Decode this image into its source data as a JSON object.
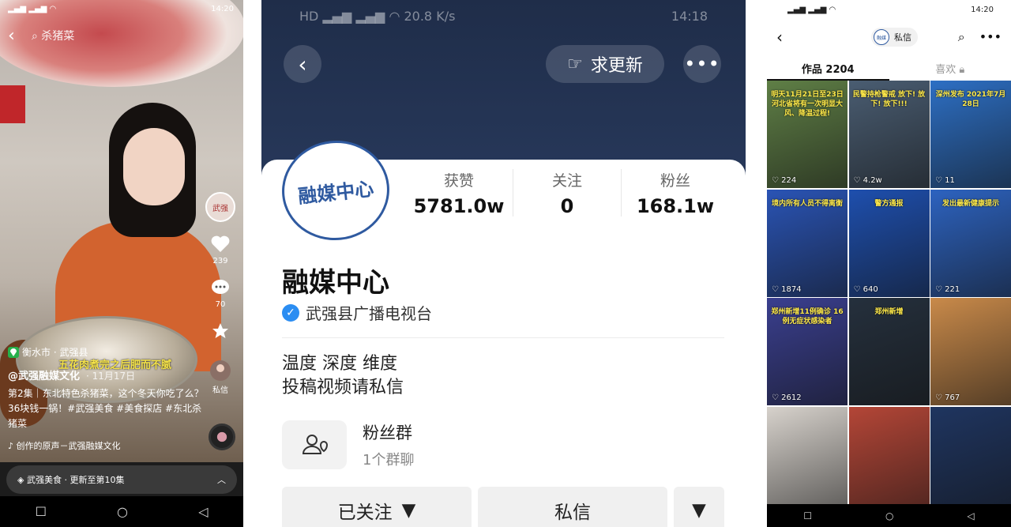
{
  "video": {
    "status": {
      "time": "14:20",
      "speed": "2.8 M/s"
    },
    "search_text": "杀猪菜",
    "location": "衡水市 · 武强县",
    "overlay_text": "五花肉煮完之后肥而不腻",
    "author": "@武强融媒文化",
    "date": "· 11月17日",
    "description": "第2集｜东北特色杀猪菜，这个冬天你吃了么？36块钱一锅！#武强美食 #美食探店 #东北杀猪菜",
    "music": "创作的原声－武强融媒文化",
    "like_count": "239",
    "comment_count": "70",
    "message_label": "私信",
    "collection_label": "武强美食 · 更新至第10集"
  },
  "profile": {
    "status": {
      "time": "14:18",
      "speed": "20.8 K/s"
    },
    "update_button": "求更新",
    "stats": [
      {
        "label": "获赞",
        "value": "5781.0w"
      },
      {
        "label": "关注",
        "value": "0"
      },
      {
        "label": "粉丝",
        "value": "168.1w"
      }
    ],
    "logo_text": "融媒中心",
    "name": "融媒中心",
    "verification": "武强县广播电视台",
    "bio_line1": "温度 深度 维度",
    "bio_line2": "投稿视频请私信",
    "fan_group_title": "粉丝群",
    "fan_group_sub": "1个群聊",
    "follow_button": "已关注",
    "message_button": "私信"
  },
  "works": {
    "status": {
      "time": "14:20",
      "speed": "5.4 K/s"
    },
    "pill_label": "私信",
    "tab_works": "作品 2204",
    "tab_likes": "喜欢",
    "items": [
      {
        "title": "明天11月21日至23日 河北省将有一次明显大风、降温过程!",
        "likes": "224",
        "color": "#5f7f46"
      },
      {
        "title": "民警持枪警戒 放下! 放下! 放下!!!",
        "likes": "4.2w",
        "color": "#4a5d72"
      },
      {
        "title": "深州发布 2021年7月28日",
        "likes": "11",
        "color": "#2d6fc4"
      },
      {
        "title": "境内所有人员不得离衡",
        "likes": "1874",
        "color": "#2a54b5"
      },
      {
        "title": "警方通报",
        "likes": "640",
        "color": "#1e4fae"
      },
      {
        "title": "发出最新健康提示",
        "likes": "221",
        "color": "#2d63c0"
      },
      {
        "title": "郑州新增11例确诊 16例无症状感染者",
        "likes": "2612",
        "color": "#3a3f8f"
      },
      {
        "title": "郑州新增",
        "likes": "",
        "color": "#25303d"
      },
      {
        "title": "",
        "likes": "767",
        "color": "#c98a4a"
      },
      {
        "title": "",
        "likes": "",
        "color": "#d7d2cc"
      },
      {
        "title": "",
        "likes": "",
        "color": "#b44637"
      },
      {
        "title": "",
        "likes": "",
        "color": "#1f3560"
      }
    ]
  }
}
